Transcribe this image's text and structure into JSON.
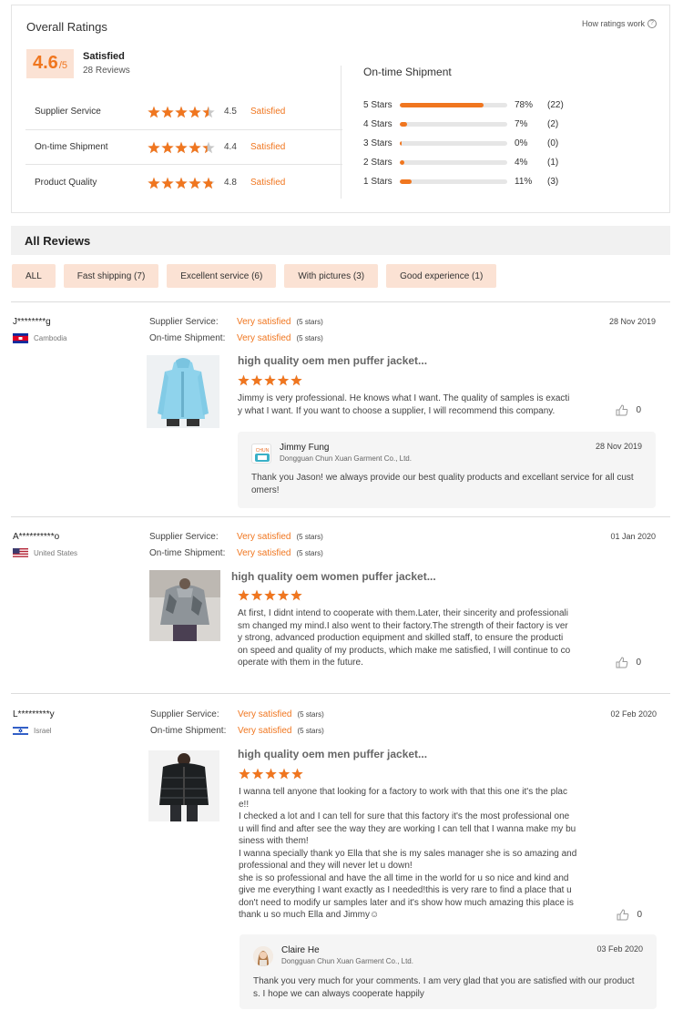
{
  "overall": {
    "title": "Overall Ratings",
    "how_link": "How ratings work",
    "score": "4.6",
    "score_suffix": "/5",
    "score_label": "Satisfied",
    "review_count": "28 Reviews",
    "categories": [
      {
        "name": "Supplier Service",
        "rating": 4.5,
        "score": "4.5",
        "text": "Satisfied"
      },
      {
        "name": "On-time Shipment",
        "rating": 4.4,
        "score": "4.4",
        "text": "Satisfied"
      },
      {
        "name": "Product Quality",
        "rating": 4.8,
        "score": "4.8",
        "text": "Satisfied"
      }
    ],
    "distribution_title": "On-time Shipment",
    "distribution": [
      {
        "label": "5 Stars",
        "fraction": 0.78,
        "pct": "78%",
        "count": "(22)"
      },
      {
        "label": "4 Stars",
        "fraction": 0.07,
        "pct": "7%",
        "count": "(2)"
      },
      {
        "label": "3 Stars",
        "fraction": 0.0,
        "pct": "0%",
        "count": "(0)"
      },
      {
        "label": "2 Stars",
        "fraction": 0.04,
        "pct": "4%",
        "count": "(1)"
      },
      {
        "label": "1 Stars",
        "fraction": 0.11,
        "pct": "11%",
        "count": "(3)"
      }
    ]
  },
  "all_reviews": {
    "title": "All Reviews",
    "filters": [
      "ALL",
      "Fast shipping (7)",
      "Excellent service (6)",
      "With pictures (3)",
      "Good experience (1)"
    ]
  },
  "colors": {
    "accent": "#f0761f",
    "chip_bg": "#fbe2d4",
    "star_empty": "#c8c8c8"
  },
  "reviews": [
    {
      "name": "J********g",
      "country": "Cambodia",
      "flag": "cambodia",
      "supplier_label": "Supplier Service:",
      "supplier_value": "Very satisfied",
      "supplier_stars": "(5 stars)",
      "shipment_label": "On-time Shipment:",
      "shipment_value": "Very satisfied",
      "shipment_stars": "(5 stars)",
      "date": "28 Nov 2019",
      "product_title": "high quality oem men puffer jacket...",
      "product_image": "light-blue-puffer-jacket",
      "rating": 5,
      "text": "Jimmy is very professional. He knows what I want. The quality of samples is exacti\ny what I want. If you want to choose a supplier, I will recommend this company.",
      "likes": "0",
      "reply": {
        "avatar": "company-logo",
        "name": "Jimmy Fung",
        "company": "Dongguan Chun Xuan Garment Co., Ltd.",
        "date": "28 Nov 2019",
        "text": "Thank you Jason! we always provide our best quality products and excellant service for all cust\nomers!"
      }
    },
    {
      "name": "A**********o",
      "country": "United States",
      "flag": "usa",
      "supplier_label": "Supplier Service:",
      "supplier_value": "Very satisfied",
      "supplier_stars": "(5 stars)",
      "shipment_label": "On-time Shipment:",
      "shipment_value": "Very satisfied",
      "shipment_stars": "(5 stars)",
      "date": "01 Jan 2020",
      "product_title": "high quality oem women puffer jacket...",
      "product_image": "grey-camo-puffer-jacket",
      "rating": 5,
      "text": "At first, I didnt intend to cooperate with them.Later, their sincerity and professionali\nsm changed my mind.I also went to their factory.The strength of their factory is ver\ny strong, advanced production equipment and skilled staff, to ensure the producti\non speed and quality of my products, which make me satisfied, I will continue to co\noperate with them in the future.",
      "likes": "0"
    },
    {
      "name": "L*********y",
      "country": "Israel",
      "flag": "israel",
      "supplier_label": "Supplier Service:",
      "supplier_value": "Very satisfied",
      "supplier_stars": "(5 stars)",
      "shipment_label": "On-time Shipment:",
      "shipment_value": "Very satisfied",
      "shipment_stars": "(5 stars)",
      "date": "02 Feb 2020",
      "product_title": "high quality oem men puffer jacket...",
      "product_image": "black-puffer-jacket",
      "rating": 5,
      "text": "I wanna tell anyone that looking for a factory to work with that this one it's the plac\ne!!\nI checked a lot and I can tell for sure that this factory it's the most professional one\nu will find and after see the way they are working I can tell that I wanna make my bu\nsiness with them!\nI wanna specially thank yo Ella that she is my sales manager she is so amazing and\nprofessional and they will never let u down!\nshe is so professional and have the all time in the world for u so nice and kind and\ngive me everything I want exactly as I needed!this is very rare to find a place that u\ndon't need to modify ur samples later and it's show how much amazing this place is\nthank u so much Ella and Jimmy☺",
      "likes": "0",
      "reply": {
        "avatar": "person-avatar",
        "name": "Claire He",
        "company": "Dongguan Chun Xuan Garment Co., Ltd.",
        "date": "03 Feb 2020",
        "text": "Thank you very much for your comments. I am very glad that you are satisfied with our product\ns. I hope we can always cooperate happily"
      }
    }
  ]
}
